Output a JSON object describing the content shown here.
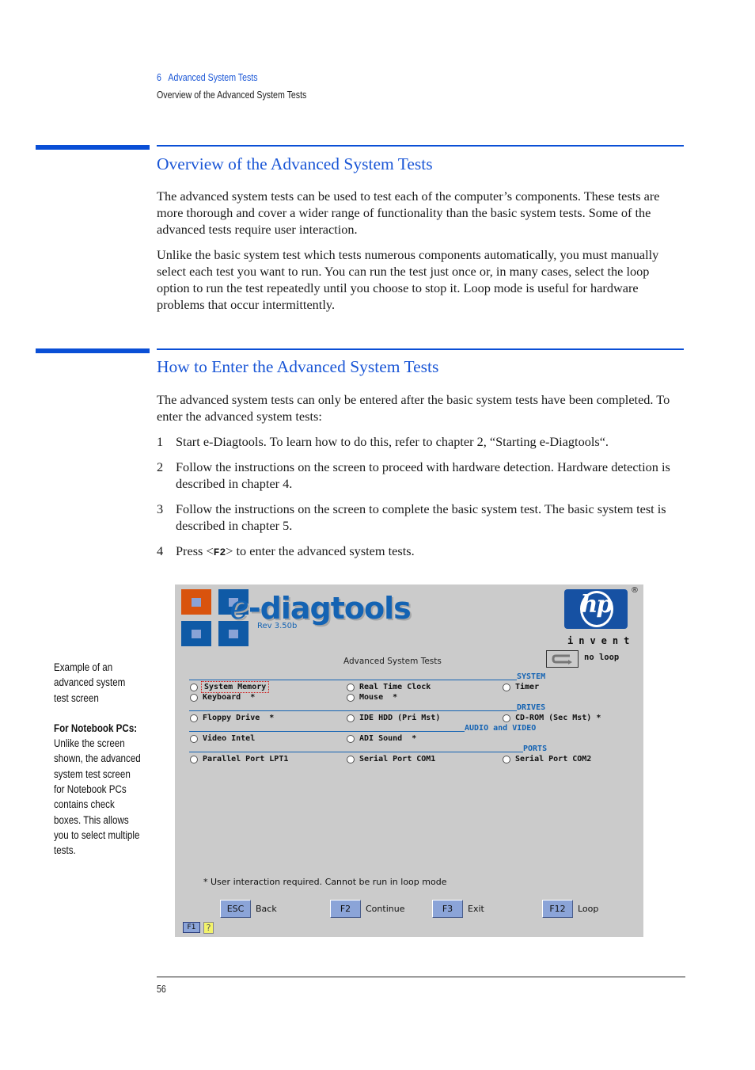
{
  "running_header": {
    "chapter_number": "6",
    "chapter_title": "Advanced System Tests",
    "section_title": "Overview of the Advanced System Tests"
  },
  "section1": {
    "heading": "Overview of the Advanced System Tests",
    "paragraphs": [
      "The advanced system tests can be used to test each of the computer’s components. These tests are more thorough and cover a wider range of functionality than the basic system tests. Some of the advanced tests require user interaction.",
      "Unlike the basic system test which tests numerous components automatically, you must manually select each test you want to run. You can run the test just once or, in many cases, select the loop option to run the test repeatedly until you choose to stop it. Loop mode is useful for hardware problems that occur intermittently."
    ]
  },
  "section2": {
    "heading": "How to Enter the Advanced System Tests",
    "intro": "The advanced system tests can only be entered after the basic system tests have been completed. To enter the advanced system tests:",
    "steps": [
      {
        "n": "1",
        "text": "Start e-Diagtools. To learn how to do this, refer to chapter 2, “Starting e-Diagtools“."
      },
      {
        "n": "2",
        "text": "Follow the instructions on the screen to proceed with hardware detection. Hardware detection is described in chapter 4."
      },
      {
        "n": "3",
        "text": "Follow the instructions on the screen to complete the basic system test. The basic system test is described in chapter 5."
      },
      {
        "n": "4",
        "pre": "Press <",
        "key": "F2",
        "post": "> to enter the advanced system tests."
      }
    ]
  },
  "side_note": {
    "caption": "Example of an advanced system test screen",
    "bold_label": "For Notebook PCs:",
    "body": "Unlike the screen shown, the advanced system test screen for Notebook PCs contains check boxes. This allows you to select multiple tests."
  },
  "screenshot": {
    "app_logo_e": "e",
    "app_logo_rest": "-diagtools",
    "revision": "Rev 3.50b",
    "brand_logo": "hp",
    "brand_registered": "®",
    "brand_tagline": "invent",
    "loop_state": "no loop",
    "screen_title": "Advanced System Tests",
    "groups": [
      {
        "label": "SYSTEM",
        "options": [
          "System Memory",
          "Real Time Clock",
          "Timer",
          "Keyboard  *",
          "Mouse  *"
        ]
      },
      {
        "label": "DRIVES",
        "options": [
          "Floppy Drive  *",
          "IDE HDD (Pri Mst)",
          "CD-ROM (Sec Mst) *"
        ]
      },
      {
        "label": "AUDIO and VIDEO",
        "options": [
          "Video Intel",
          "ADI Sound  *"
        ]
      },
      {
        "label": "PORTS",
        "options": [
          "Parallel Port LPT1",
          "Serial Port COM1",
          "Serial Port COM2"
        ]
      }
    ],
    "focused_option": "System Memory",
    "footnote": "* User interaction required. Cannot be run in loop mode",
    "function_keys": [
      {
        "key": "ESC",
        "label": "Back"
      },
      {
        "key": "F2",
        "label": "Continue"
      },
      {
        "key": "F3",
        "label": "Exit"
      },
      {
        "key": "F12",
        "label": "Loop"
      }
    ],
    "help_key": "F1",
    "help_icon": "?"
  },
  "footer": {
    "page_number": "56"
  },
  "colors": {
    "accent_blue": "#0a4fd6",
    "heading_blue": "#1a56d6",
    "screen_bg": "#cbcbcb",
    "app_blue": "#1463b3",
    "logo_orange": "#d9530d",
    "fkey_bg": "#8ba4d8"
  }
}
